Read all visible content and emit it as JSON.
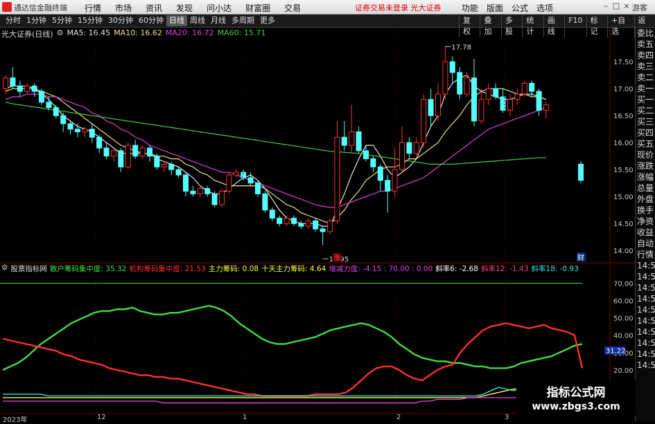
{
  "app": {
    "title": "通达信金融终端",
    "menu": [
      "行情",
      "市场",
      "资讯",
      "发现",
      "问小达",
      "财富圈",
      "交易"
    ],
    "notice": "证券交易未登录  光大证券",
    "right_menu": [
      "功能",
      "版面",
      "公式",
      "选项"
    ],
    "guest": "游客",
    "window_controls": [
      "minimize-icon",
      "maximize-icon",
      "close-icon"
    ]
  },
  "toolbar": {
    "periods": [
      "分时",
      "1分钟",
      "5分钟",
      "15分钟",
      "30分钟",
      "60分钟",
      "日线",
      "周线",
      "月线",
      "多周期",
      "更多"
    ],
    "active_period": "日线",
    "tools": [
      "复权",
      "叠加",
      "多股",
      "统计",
      "画线",
      "F10",
      "标记",
      "+自选",
      "返回"
    ]
  },
  "stock": {
    "name": "光大证券(日线)",
    "ma": [
      {
        "label": "MA5: 16.45",
        "color": "#e8e8e8"
      },
      {
        "label": "MA10: 16.62",
        "color": "#f0e68c"
      },
      {
        "label": "MA20: 16.72",
        "color": "#e040e0"
      },
      {
        "label": "MA60: 15.71",
        "color": "#40d040"
      }
    ],
    "high_label": "17.78",
    "low_label": "13.95",
    "marker_zhang": "涨",
    "marker_cai": "财"
  },
  "price_axis": [
    "17.50",
    "17.00",
    "16.50",
    "16.00",
    "15.50",
    "15.00",
    "14.50",
    "14.00"
  ],
  "indicator": {
    "name": "股票指标网",
    "items": [
      {
        "label": "散户筹码集中度: 35.32",
        "color": "#40e040"
      },
      {
        "label": "机构筹码集中度: 21.53",
        "color": "#ff3030"
      },
      {
        "label": "主力筹码: 0.08",
        "color": "#ffff40"
      },
      {
        "label": "十天主力筹码: 4.64",
        "color": "#ffff40"
      },
      {
        "label": "增减力度: -4.15 : 70.00 : 0.00",
        "color": "#e040e0"
      },
      {
        "label": "斜率6: -2.68",
        "color": "#ffffff"
      },
      {
        "label": "斜率12: -1.43",
        "color": "#ff4080"
      },
      {
        "label": "斜率18: -0.93",
        "color": "#40e0e0"
      }
    ],
    "axis": [
      "70.00",
      "60.00",
      "50.00",
      "40.00",
      "30.00",
      "20.00"
    ],
    "current_value": "31.22"
  },
  "right_panel": [
    "委比",
    "卖五",
    "卖四",
    "卖三",
    "卖二",
    "卖一",
    "买一",
    "买二",
    "买三",
    "买四",
    "买五",
    "现价",
    "涨跌",
    "涨幅",
    "总量",
    "外盘",
    "换手",
    "净资",
    "收益",
    "自动",
    "行情",
    "14:5",
    "14:5",
    "14:5",
    "14:5",
    "14:5",
    "14:5",
    "14:5",
    "14:5",
    "14:5",
    "14:5"
  ],
  "x_axis": [
    "2023年",
    "12",
    "1",
    "2",
    "3"
  ],
  "watermark": {
    "line1": "指标公式网",
    "line2": "www.zbgs3.com"
  },
  "chart_data": {
    "type": "candlestick",
    "price_range": [
      13.9,
      17.9
    ],
    "candles": [
      [
        17.0,
        17.2,
        16.9,
        17.25
      ],
      [
        17.2,
        17.05,
        17.0,
        17.4
      ],
      [
        17.05,
        16.95,
        16.85,
        17.15
      ],
      [
        16.95,
        17.05,
        16.9,
        17.1
      ],
      [
        17.05,
        16.95,
        16.85,
        17.1
      ],
      [
        16.95,
        16.75,
        16.7,
        17.0
      ],
      [
        16.75,
        16.65,
        16.6,
        16.85
      ],
      [
        16.65,
        16.5,
        16.45,
        16.7
      ],
      [
        16.5,
        16.35,
        16.2,
        16.55
      ],
      [
        16.35,
        16.25,
        16.15,
        16.4
      ],
      [
        16.25,
        16.2,
        16.1,
        16.35
      ],
      [
        16.2,
        16.25,
        16.1,
        16.3
      ],
      [
        16.25,
        16.1,
        16.0,
        16.35
      ],
      [
        16.1,
        15.9,
        15.8,
        16.15
      ],
      [
        15.9,
        15.75,
        15.7,
        16.0
      ],
      [
        15.75,
        15.85,
        15.65,
        15.9
      ],
      [
        15.85,
        15.55,
        15.45,
        15.9
      ],
      [
        15.55,
        15.95,
        15.5,
        16.0
      ],
      [
        15.95,
        15.75,
        15.7,
        16.05
      ],
      [
        15.75,
        15.9,
        15.7,
        15.95
      ],
      [
        15.9,
        15.75,
        15.65,
        15.95
      ],
      [
        15.75,
        15.55,
        15.5,
        15.8
      ],
      [
        15.55,
        15.6,
        15.45,
        15.65
      ],
      [
        15.6,
        15.5,
        15.4,
        15.65
      ],
      [
        15.5,
        15.4,
        15.35,
        15.55
      ],
      [
        15.4,
        15.1,
        15.0,
        15.45
      ],
      [
        15.1,
        15.05,
        15.0,
        15.2
      ],
      [
        15.05,
        15.15,
        15.0,
        15.2
      ],
      [
        15.15,
        15.05,
        15.0,
        15.2
      ],
      [
        15.05,
        14.85,
        14.8,
        15.1
      ],
      [
        14.85,
        15.1,
        14.8,
        15.15
      ],
      [
        15.1,
        15.4,
        15.05,
        15.45
      ],
      [
        15.4,
        15.45,
        15.35,
        15.5
      ],
      [
        15.45,
        15.35,
        15.3,
        15.5
      ],
      [
        15.35,
        15.25,
        15.2,
        15.45
      ],
      [
        15.25,
        15.05,
        15.0,
        15.3
      ],
      [
        15.05,
        14.75,
        14.7,
        15.1
      ],
      [
        14.75,
        14.6,
        14.55,
        14.8
      ],
      [
        14.6,
        14.5,
        14.45,
        14.65
      ],
      [
        14.5,
        14.6,
        14.45,
        14.65
      ],
      [
        14.6,
        14.5,
        14.45,
        14.65
      ],
      [
        14.5,
        14.45,
        14.4,
        14.55
      ],
      [
        14.45,
        14.55,
        14.4,
        14.6
      ],
      [
        14.55,
        14.4,
        14.35,
        14.6
      ],
      [
        14.4,
        14.35,
        14.1,
        14.45
      ],
      [
        14.35,
        14.55,
        14.3,
        14.6
      ],
      [
        14.55,
        16.1,
        14.5,
        16.4
      ],
      [
        16.1,
        15.95,
        15.85,
        16.4
      ],
      [
        15.95,
        16.2,
        15.8,
        16.7
      ],
      [
        16.2,
        15.85,
        15.8,
        16.3
      ],
      [
        15.85,
        15.7,
        15.65,
        15.95
      ],
      [
        15.7,
        15.55,
        15.45,
        15.75
      ],
      [
        15.55,
        15.3,
        15.1,
        15.6
      ],
      [
        15.3,
        15.1,
        14.7,
        15.4
      ],
      [
        15.1,
        15.5,
        15.0,
        15.9
      ],
      [
        15.5,
        16.0,
        15.45,
        16.3
      ],
      [
        16.0,
        15.8,
        15.7,
        16.1
      ],
      [
        15.8,
        16.0,
        15.75,
        16.1
      ],
      [
        16.0,
        16.8,
        15.9,
        16.9
      ],
      [
        16.8,
        16.5,
        16.3,
        17.0
      ],
      [
        16.5,
        16.9,
        16.4,
        17.1
      ],
      [
        16.9,
        17.5,
        16.8,
        17.78
      ],
      [
        17.5,
        17.3,
        17.1,
        17.6
      ],
      [
        17.3,
        16.9,
        16.8,
        17.4
      ],
      [
        16.9,
        17.2,
        16.85,
        17.3
      ],
      [
        17.2,
        16.4,
        16.3,
        17.55
      ],
      [
        16.4,
        16.8,
        16.35,
        17.0
      ],
      [
        16.8,
        17.0,
        16.7,
        17.1
      ],
      [
        17.0,
        16.85,
        16.8,
        17.1
      ],
      [
        16.85,
        16.6,
        16.55,
        17.0
      ],
      [
        16.6,
        16.8,
        16.5,
        16.9
      ],
      [
        16.8,
        16.9,
        16.7,
        17.0
      ],
      [
        16.9,
        17.1,
        16.85,
        17.15
      ],
      [
        17.1,
        16.95,
        16.85,
        17.15
      ],
      [
        16.95,
        16.6,
        16.5,
        17.0
      ],
      [
        16.6,
        16.7,
        16.45,
        16.75
      ],
      [
        15.6,
        15.3,
        15.25,
        15.65
      ]
    ],
    "ma_lines": [
      {
        "name": "MA5",
        "color": "#e8e8e8",
        "values": [
          17.0,
          17.05,
          17.05,
          17.05,
          17.0,
          16.9,
          16.8,
          16.65,
          16.5,
          16.4,
          16.3,
          16.25,
          16.2,
          16.1,
          16.0,
          15.9,
          15.8,
          15.8,
          15.8,
          15.8,
          15.8,
          15.7,
          15.65,
          15.6,
          15.55,
          15.45,
          15.35,
          15.2,
          15.1,
          15.05,
          15.05,
          15.15,
          15.25,
          15.35,
          15.4,
          15.3,
          15.15,
          14.95,
          14.75,
          14.6,
          14.55,
          14.5,
          14.5,
          14.5,
          14.45,
          14.45,
          14.75,
          15.05,
          15.4,
          15.7,
          15.95,
          15.95,
          15.75,
          15.5,
          15.35,
          15.45,
          15.55,
          15.7,
          16.0,
          16.3,
          16.5,
          16.9,
          17.1,
          17.2,
          17.25,
          17.05,
          16.95,
          16.9,
          16.85,
          16.8,
          16.8,
          16.85,
          16.9,
          16.9,
          16.85,
          16.8,
          16.45
        ]
      },
      {
        "name": "MA10",
        "color": "#f0e68c",
        "values": [
          16.95,
          17.0,
          17.0,
          17.0,
          17.0,
          16.95,
          16.9,
          16.85,
          16.75,
          16.65,
          16.55,
          16.45,
          16.35,
          16.25,
          16.15,
          16.05,
          15.95,
          15.9,
          15.85,
          15.8,
          15.8,
          15.75,
          15.75,
          15.7,
          15.7,
          15.6,
          15.55,
          15.45,
          15.4,
          15.3,
          15.25,
          15.2,
          15.2,
          15.2,
          15.2,
          15.2,
          15.15,
          15.05,
          14.95,
          14.85,
          14.8,
          14.7,
          14.65,
          14.6,
          14.55,
          14.5,
          14.6,
          14.75,
          14.95,
          15.1,
          15.3,
          15.4,
          15.5,
          15.55,
          15.55,
          15.6,
          15.7,
          15.7,
          15.8,
          15.9,
          16.0,
          16.2,
          16.35,
          16.5,
          16.7,
          16.85,
          16.95,
          17.0,
          17.0,
          17.0,
          16.95,
          16.9,
          16.9,
          16.85,
          16.85,
          16.8,
          16.62
        ]
      },
      {
        "name": "MA20",
        "color": "#e040e0",
        "values": [
          16.8,
          16.85,
          16.85,
          16.9,
          16.9,
          16.9,
          16.85,
          16.85,
          16.8,
          16.75,
          16.7,
          16.65,
          16.55,
          16.5,
          16.4,
          16.35,
          16.25,
          16.2,
          16.1,
          16.05,
          15.95,
          15.9,
          15.85,
          15.8,
          15.75,
          15.7,
          15.65,
          15.6,
          15.55,
          15.5,
          15.45,
          15.45,
          15.4,
          15.35,
          15.3,
          15.25,
          15.2,
          15.15,
          15.1,
          15.05,
          15.0,
          14.95,
          14.9,
          14.85,
          14.82,
          14.8,
          14.8,
          14.85,
          14.9,
          14.95,
          15.0,
          15.05,
          15.1,
          15.1,
          15.15,
          15.2,
          15.25,
          15.3,
          15.35,
          15.45,
          15.55,
          15.65,
          15.75,
          15.85,
          15.95,
          16.05,
          16.15,
          16.25,
          16.3,
          16.35,
          16.4,
          16.45,
          16.5,
          16.55,
          16.6,
          16.65,
          16.72
        ]
      },
      {
        "name": "MA60",
        "color": "#40d040",
        "values": [
          16.75,
          16.72,
          16.7,
          16.68,
          16.66,
          16.64,
          16.62,
          16.6,
          16.58,
          16.56,
          16.54,
          16.52,
          16.5,
          16.48,
          16.46,
          16.44,
          16.42,
          16.4,
          16.38,
          16.36,
          16.34,
          16.32,
          16.3,
          16.28,
          16.26,
          16.24,
          16.22,
          16.2,
          16.18,
          16.16,
          16.14,
          16.12,
          16.1,
          16.08,
          16.06,
          16.04,
          16.02,
          16.0,
          15.98,
          15.96,
          15.94,
          15.92,
          15.9,
          15.88,
          15.86,
          15.84,
          15.83,
          15.82,
          15.81,
          15.8,
          15.78,
          15.76,
          15.74,
          15.72,
          15.7,
          15.68,
          15.66,
          15.64,
          15.62,
          15.6,
          15.6,
          15.6,
          15.6,
          15.61,
          15.62,
          15.63,
          15.64,
          15.65,
          15.66,
          15.67,
          15.68,
          15.69,
          15.7,
          15.71,
          15.72,
          15.72,
          15.71
        ]
      }
    ],
    "indicator_range": [
      0,
      75
    ],
    "indicator_series": [
      {
        "name": "散户筹码集中度",
        "color": "#40e040",
        "values": [
          20,
          22,
          24,
          27,
          31,
          35,
          38,
          41,
          44,
          47,
          49,
          51,
          53,
          54,
          54,
          55,
          55,
          56,
          54,
          53,
          52,
          52,
          53,
          53,
          54,
          55,
          56,
          57,
          56,
          54,
          51,
          47,
          44,
          41,
          38,
          36,
          35,
          35,
          36,
          37,
          38,
          39,
          41,
          43,
          44,
          45,
          46,
          47,
          46,
          44,
          42,
          39,
          35,
          32,
          29,
          27,
          26,
          25,
          25,
          24,
          24,
          23,
          22,
          22,
          21,
          21,
          21,
          22,
          24,
          25,
          26,
          27,
          28,
          30,
          32,
          34,
          35
        ]
      },
      {
        "name": "机构筹码集中度",
        "color": "#ff3030",
        "values": [
          38,
          37,
          36,
          35,
          34,
          33,
          32,
          31,
          29,
          28,
          26,
          25,
          24,
          23,
          21,
          20,
          19,
          18,
          17,
          17,
          16,
          16,
          15,
          15,
          14,
          13,
          12,
          11,
          10,
          9,
          8,
          7,
          6,
          6,
          5,
          5,
          5,
          5,
          5,
          5,
          5,
          6,
          6,
          6,
          6,
          7,
          10,
          14,
          18,
          21,
          22,
          22,
          20,
          17,
          15,
          14,
          17,
          20,
          22,
          23,
          30,
          35,
          39,
          43,
          45,
          46,
          47,
          46,
          45,
          44,
          45,
          46,
          44,
          43,
          42,
          40,
          21
        ]
      },
      {
        "name": "主力筹码",
        "color": "#ffff40",
        "values": [
          4,
          4,
          4,
          4,
          4,
          4,
          4,
          4,
          4,
          4,
          4,
          4,
          4,
          4,
          4,
          4,
          4,
          4,
          4,
          4,
          4,
          4,
          4,
          4,
          4,
          4,
          4,
          4,
          4,
          4,
          4,
          4,
          4,
          4,
          4,
          4,
          4,
          4,
          4,
          4,
          4,
          4,
          4,
          4,
          4,
          4,
          4,
          4,
          4,
          4,
          4,
          4,
          4,
          4,
          4,
          4,
          4,
          4,
          4,
          4,
          4,
          4,
          4,
          5,
          6,
          7,
          8,
          9,
          9,
          8,
          8,
          7,
          7,
          7,
          6,
          6,
          6
        ]
      },
      {
        "name": "增减力度",
        "color": "#e040e0",
        "values": [
          2,
          2,
          2,
          2,
          2,
          2,
          2,
          2,
          2,
          2,
          2,
          2,
          2,
          2,
          2,
          2,
          2,
          2,
          2,
          2,
          2,
          1,
          1,
          1,
          1,
          1,
          1,
          1,
          1,
          1,
          1,
          1,
          1,
          1,
          1,
          1,
          1,
          1,
          1,
          1,
          1,
          1,
          1,
          1,
          1,
          1,
          1,
          1,
          1,
          1,
          1,
          1,
          1,
          1,
          1,
          2,
          2,
          3,
          3,
          3,
          3,
          4,
          4,
          4,
          4,
          4,
          4,
          4,
          4,
          4,
          4,
          4,
          3,
          3,
          3,
          3,
          3
        ]
      },
      {
        "name": "斜率18",
        "color": "#40e0e0",
        "values": [
          6,
          6,
          6,
          6,
          6,
          6,
          5,
          5,
          5,
          5,
          5,
          5,
          5,
          5,
          5,
          5,
          5,
          5,
          5,
          5,
          5,
          5,
          5,
          5,
          5,
          5,
          5,
          5,
          5,
          5,
          5,
          5,
          5,
          5,
          5,
          5,
          5,
          5,
          5,
          5,
          5,
          5,
          5,
          5,
          5,
          5,
          5,
          5,
          5,
          5,
          5,
          5,
          5,
          5,
          5,
          5,
          5,
          5,
          5,
          5,
          5,
          5,
          5,
          6,
          8,
          10,
          9,
          8,
          10,
          12,
          13,
          12,
          11,
          10,
          9,
          8,
          7
        ]
      }
    ]
  }
}
